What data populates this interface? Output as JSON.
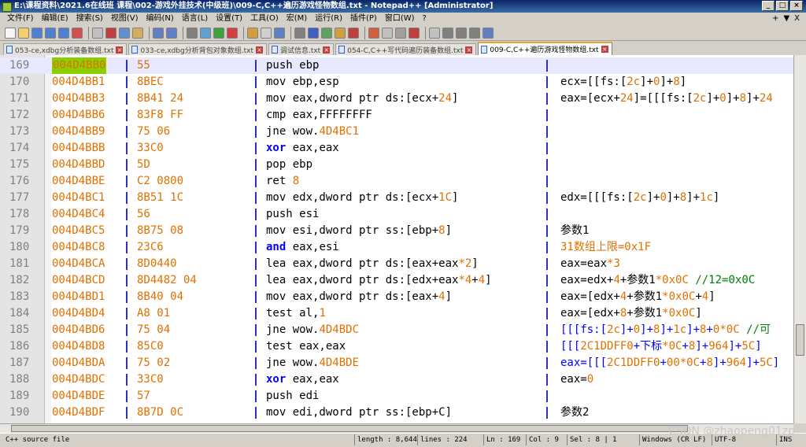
{
  "window": {
    "title": "E:\\课程资料\\2021.6在线班 课程\\002-游戏外挂技术(中级班)\\009-C,C++遍历游戏怪物数组.txt - Notepad++ [Administrator]",
    "controls": [
      "minimize",
      "maximize",
      "close"
    ]
  },
  "menu": {
    "items": [
      "文件(F)",
      "编辑(E)",
      "搜索(S)",
      "视图(V)",
      "编码(N)",
      "语言(L)",
      "设置(T)",
      "工具(O)",
      "宏(M)",
      "运行(R)",
      "插件(P)",
      "窗口(W)",
      "?"
    ],
    "right": [
      "+",
      "▼",
      "X"
    ]
  },
  "tabs": [
    {
      "label": "053-ce,xdbg分析装备数组.txt",
      "active": false
    },
    {
      "label": "033-ce,xdbg分析背包对象数组.txt",
      "active": false
    },
    {
      "label": "调试信息.txt",
      "active": false
    },
    {
      "label": "054-C,C++写代码遍历装备数组.txt",
      "active": false
    },
    {
      "label": "009-C,C++遍历游戏怪物数组.txt",
      "active": true
    }
  ],
  "lines": [
    {
      "n": "169",
      "addr": "004D4BB0",
      "bytes": "55",
      "asm": [
        {
          "t": "push ebp"
        }
      ],
      "cmt": [],
      "current": true
    },
    {
      "n": "170",
      "addr": "004D4BB1",
      "bytes": "8BEC",
      "asm": [
        {
          "t": "mov ebp,esp"
        }
      ],
      "cmt": [
        {
          "t": "ecx=[[fs:[",
          "c": "k"
        },
        {
          "t": "2c",
          "c": "o"
        },
        {
          "t": "]+",
          "c": "k"
        },
        {
          "t": "0",
          "c": "o"
        },
        {
          "t": "]+",
          "c": "k"
        },
        {
          "t": "8",
          "c": "o"
        },
        {
          "t": "]",
          "c": "k"
        }
      ]
    },
    {
      "n": "171",
      "addr": "004D4BB3",
      "bytes": "8B41 24",
      "asm": [
        {
          "t": "mov eax,dword ptr ds:[ecx+"
        },
        {
          "t": "24",
          "c": "num"
        },
        {
          "t": "]"
        }
      ],
      "cmt": [
        {
          "t": "eax=[ecx+",
          "c": "k"
        },
        {
          "t": "24",
          "c": "o"
        },
        {
          "t": "]=[[[fs:[",
          "c": "k"
        },
        {
          "t": "2c",
          "c": "o"
        },
        {
          "t": "]+",
          "c": "k"
        },
        {
          "t": "0",
          "c": "o"
        },
        {
          "t": "]+",
          "c": "k"
        },
        {
          "t": "8",
          "c": "o"
        },
        {
          "t": "]+",
          "c": "k"
        },
        {
          "t": "24",
          "c": "o"
        }
      ]
    },
    {
      "n": "172",
      "addr": "004D4BB6",
      "bytes": "83F8 FF",
      "asm": [
        {
          "t": "cmp eax,FFFFFFFF"
        }
      ],
      "cmt": []
    },
    {
      "n": "173",
      "addr": "004D4BB9",
      "bytes": "75 06",
      "asm": [
        {
          "t": "jne wow."
        },
        {
          "t": "4D4BC1",
          "c": "num"
        }
      ],
      "cmt": []
    },
    {
      "n": "174",
      "addr": "004D4BBB",
      "bytes": "33C0",
      "asm": [
        {
          "t": "xor",
          "c": "kw"
        },
        {
          "t": " eax,eax"
        }
      ],
      "cmt": []
    },
    {
      "n": "175",
      "addr": "004D4BBD",
      "bytes": "5D",
      "asm": [
        {
          "t": "pop ebp"
        }
      ],
      "cmt": []
    },
    {
      "n": "176",
      "addr": "004D4BBE",
      "bytes": "C2 0800",
      "asm": [
        {
          "t": "ret "
        },
        {
          "t": "8",
          "c": "num"
        }
      ],
      "cmt": []
    },
    {
      "n": "177",
      "addr": "004D4BC1",
      "bytes": "8B51 1C",
      "asm": [
        {
          "t": "mov edx,dword ptr ds:[ecx+"
        },
        {
          "t": "1C",
          "c": "num"
        },
        {
          "t": "]"
        }
      ],
      "cmt": [
        {
          "t": "edx=[[[fs:[",
          "c": "k"
        },
        {
          "t": "2c",
          "c": "o"
        },
        {
          "t": "]+",
          "c": "k"
        },
        {
          "t": "0",
          "c": "o"
        },
        {
          "t": "]+",
          "c": "k"
        },
        {
          "t": "8",
          "c": "o"
        },
        {
          "t": "]+",
          "c": "k"
        },
        {
          "t": "1c",
          "c": "o"
        },
        {
          "t": "]",
          "c": "k"
        }
      ]
    },
    {
      "n": "178",
      "addr": "004D4BC4",
      "bytes": "56",
      "asm": [
        {
          "t": "push esi"
        }
      ],
      "cmt": []
    },
    {
      "n": "179",
      "addr": "004D4BC5",
      "bytes": "8B75 08",
      "asm": [
        {
          "t": "mov esi,dword ptr ss:[ebp+"
        },
        {
          "t": "8",
          "c": "num"
        },
        {
          "t": "]"
        }
      ],
      "cmt": [
        {
          "t": "参数1",
          "c": "k"
        }
      ]
    },
    {
      "n": "180",
      "addr": "004D4BC8",
      "bytes": "23C6",
      "asm": [
        {
          "t": "and",
          "c": "kw"
        },
        {
          "t": " eax,esi"
        }
      ],
      "cmt": [
        {
          "t": "31数组上限=0x1F",
          "c": "o"
        }
      ]
    },
    {
      "n": "181",
      "addr": "004D4BCA",
      "bytes": "8D0440",
      "asm": [
        {
          "t": "lea eax,dword ptr ds:[eax+eax"
        },
        {
          "t": "*2",
          "c": "num"
        },
        {
          "t": "]"
        }
      ],
      "cmt": [
        {
          "t": "eax=eax",
          "c": "k"
        },
        {
          "t": "*3",
          "c": "o"
        }
      ]
    },
    {
      "n": "182",
      "addr": "004D4BCD",
      "bytes": "8D4482 04",
      "asm": [
        {
          "t": "lea eax,dword ptr ds:[edx+eax"
        },
        {
          "t": "*4",
          "c": "num"
        },
        {
          "t": "+"
        },
        {
          "t": "4",
          "c": "num"
        },
        {
          "t": "]"
        }
      ],
      "cmt": [
        {
          "t": "eax=edx+",
          "c": "k"
        },
        {
          "t": "4",
          "c": "o"
        },
        {
          "t": "+参数1",
          "c": "k"
        },
        {
          "t": "*0x0C",
          "c": "o"
        },
        {
          "t": " //12=0x0C",
          "c": "g"
        }
      ]
    },
    {
      "n": "183",
      "addr": "004D4BD1",
      "bytes": "8B40 04",
      "asm": [
        {
          "t": "mov eax,dword ptr ds:[eax+"
        },
        {
          "t": "4",
          "c": "num"
        },
        {
          "t": "]"
        }
      ],
      "cmt": [
        {
          "t": "eax=[edx+",
          "c": "k"
        },
        {
          "t": "4",
          "c": "o"
        },
        {
          "t": "+参数1",
          "c": "k"
        },
        {
          "t": "*0x0C",
          "c": "o"
        },
        {
          "t": "+",
          "c": "k"
        },
        {
          "t": "4",
          "c": "o"
        },
        {
          "t": "]",
          "c": "k"
        }
      ]
    },
    {
      "n": "184",
      "addr": "004D4BD4",
      "bytes": "A8 01",
      "asm": [
        {
          "t": "test al,"
        },
        {
          "t": "1",
          "c": "num"
        }
      ],
      "cmt": [
        {
          "t": "eax=[edx+",
          "c": "k"
        },
        {
          "t": "8",
          "c": "o"
        },
        {
          "t": "+参数1",
          "c": "k"
        },
        {
          "t": "*0x0C",
          "c": "o"
        },
        {
          "t": "]",
          "c": "k"
        }
      ]
    },
    {
      "n": "185",
      "addr": "004D4BD6",
      "bytes": "75 04",
      "asm": [
        {
          "t": "jne wow."
        },
        {
          "t": "4D4BDC",
          "c": "num"
        }
      ],
      "cmt": [
        {
          "t": "[[[fs:[",
          "c": "b"
        },
        {
          "t": "2c",
          "c": "o"
        },
        {
          "t": "]+",
          "c": "b"
        },
        {
          "t": "0",
          "c": "o"
        },
        {
          "t": "]+",
          "c": "b"
        },
        {
          "t": "8",
          "c": "o"
        },
        {
          "t": "]+",
          "c": "b"
        },
        {
          "t": "1c",
          "c": "o"
        },
        {
          "t": "]+",
          "c": "b"
        },
        {
          "t": "8",
          "c": "o"
        },
        {
          "t": "+",
          "c": "b"
        },
        {
          "t": "0",
          "c": "o"
        },
        {
          "t": "*0C",
          "c": "o"
        },
        {
          "t": " //可",
          "c": "g"
        }
      ]
    },
    {
      "n": "186",
      "addr": "004D4BD8",
      "bytes": "85C0",
      "asm": [
        {
          "t": "test eax,eax"
        }
      ],
      "cmt": [
        {
          "t": "[[[",
          "c": "b"
        },
        {
          "t": "2C1DDFF0",
          "c": "o"
        },
        {
          "t": "+下标",
          "c": "b"
        },
        {
          "t": "*0C",
          "c": "o"
        },
        {
          "t": "+",
          "c": "b"
        },
        {
          "t": "8",
          "c": "o"
        },
        {
          "t": "]+",
          "c": "b"
        },
        {
          "t": "964",
          "c": "o"
        },
        {
          "t": "]+",
          "c": "b"
        },
        {
          "t": "5C",
          "c": "o"
        },
        {
          "t": "]",
          "c": "b"
        }
      ]
    },
    {
      "n": "187",
      "addr": "004D4BDA",
      "bytes": "75 02",
      "asm": [
        {
          "t": "jne wow."
        },
        {
          "t": "4D4BDE",
          "c": "num"
        }
      ],
      "cmt": [
        {
          "t": "eax=[[[",
          "c": "b"
        },
        {
          "t": "2C1DDFF0",
          "c": "o"
        },
        {
          "t": "+",
          "c": "b"
        },
        {
          "t": "00",
          "c": "o"
        },
        {
          "t": "*0C",
          "c": "o"
        },
        {
          "t": "+",
          "c": "b"
        },
        {
          "t": "8",
          "c": "o"
        },
        {
          "t": "]+",
          "c": "b"
        },
        {
          "t": "964",
          "c": "o"
        },
        {
          "t": "]+",
          "c": "b"
        },
        {
          "t": "5C",
          "c": "o"
        },
        {
          "t": "]",
          "c": "b"
        }
      ]
    },
    {
      "n": "188",
      "addr": "004D4BDC",
      "bytes": "33C0",
      "asm": [
        {
          "t": "xor",
          "c": "kw"
        },
        {
          "t": " eax,eax"
        }
      ],
      "cmt": [
        {
          "t": "eax=",
          "c": "k"
        },
        {
          "t": "0",
          "c": "o"
        }
      ]
    },
    {
      "n": "189",
      "addr": "004D4BDE",
      "bytes": "57",
      "asm": [
        {
          "t": "push edi"
        }
      ],
      "cmt": []
    },
    {
      "n": "190",
      "addr": "004D4BDF",
      "bytes": "8B7D 0C",
      "asm": [
        {
          "t": "mov edi,dword ptr ss:[ebp+C]"
        }
      ],
      "cmt": [
        {
          "t": "参数2",
          "c": "k"
        }
      ]
    }
  ],
  "status": {
    "file_type": "C++ source file",
    "length": "length : 8,644",
    "lines": "lines : 224",
    "ln": "Ln : 169",
    "col": "Col : 9",
    "sel": "Sel : 8 | 1",
    "eol": "Windows (CR LF)",
    "encoding": "UTF-8",
    "mode": "INS"
  },
  "watermark": "CSDN @zhaopeng01zp"
}
